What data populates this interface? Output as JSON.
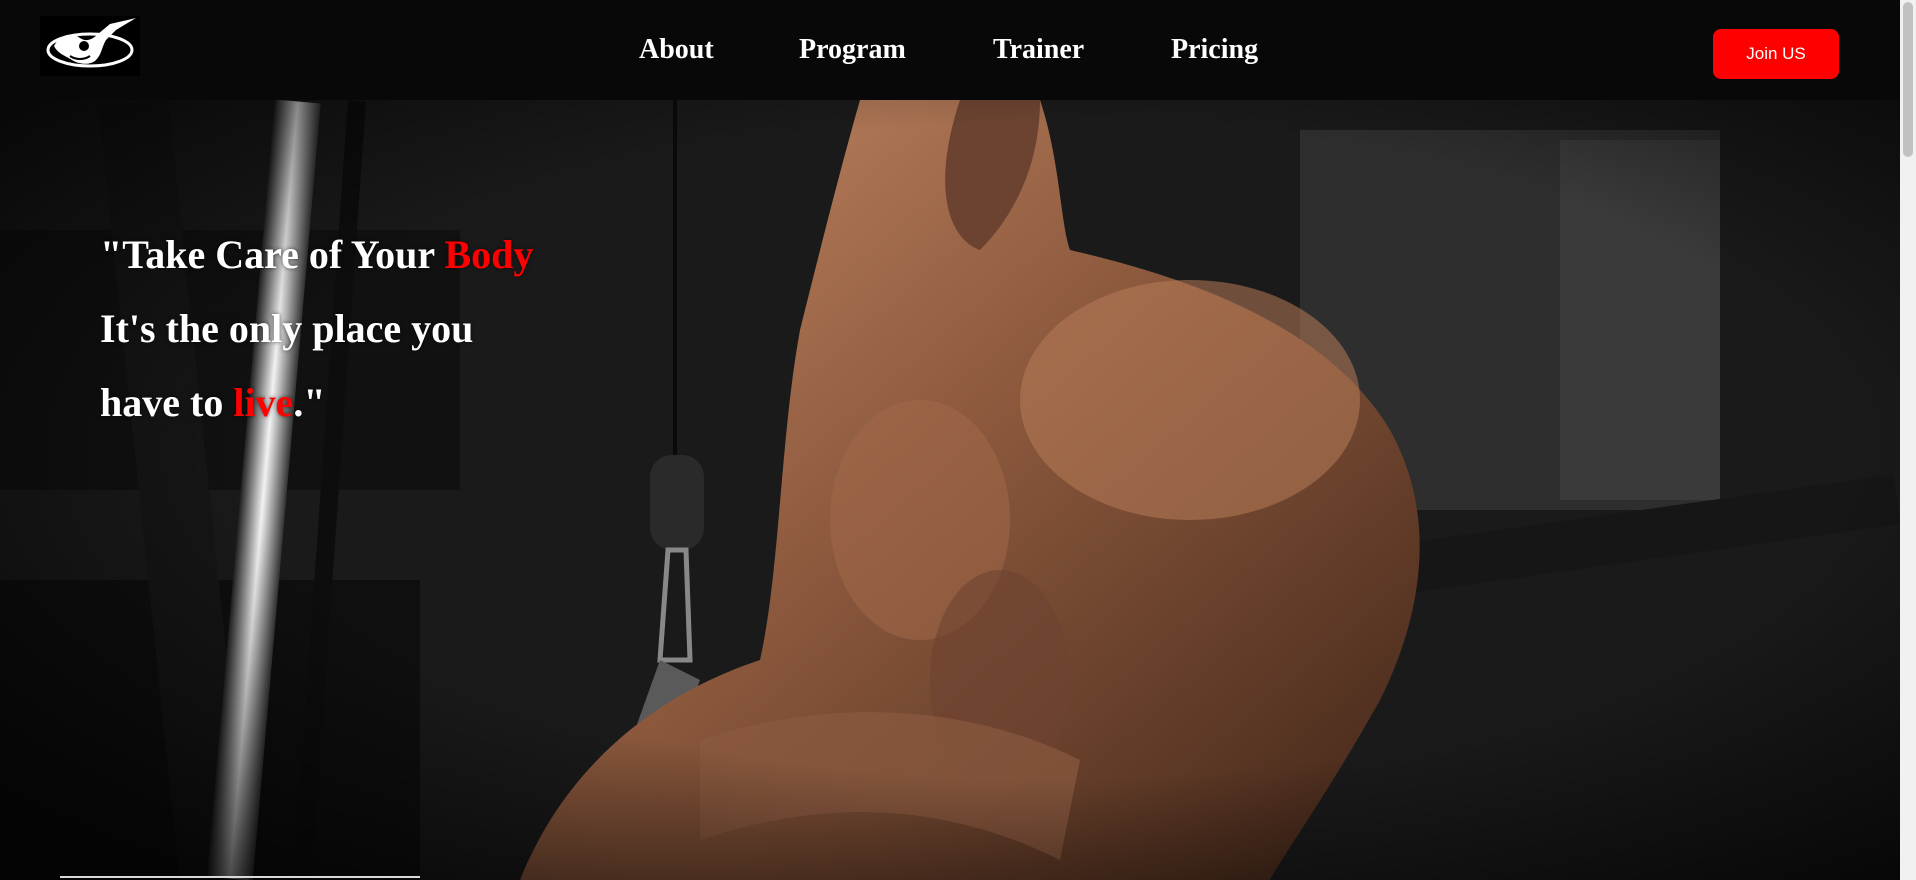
{
  "header": {
    "logo_icon": "bodybuilder-logo-icon",
    "nav": [
      "About",
      "Program",
      "Trainer",
      "Pricing"
    ],
    "cta_label": "Join US"
  },
  "hero": {
    "quote_line1_prefix": "\"Take Care of Your ",
    "quote_line1_accent": "Body",
    "quote_line2": "It's the only place you",
    "quote_line3_prefix": "have to ",
    "quote_line3_accent": "live",
    "quote_line3_suffix": ".\""
  },
  "colors": {
    "accent": "#ff0000",
    "header_bg": "#080808",
    "text": "#ffffff"
  }
}
